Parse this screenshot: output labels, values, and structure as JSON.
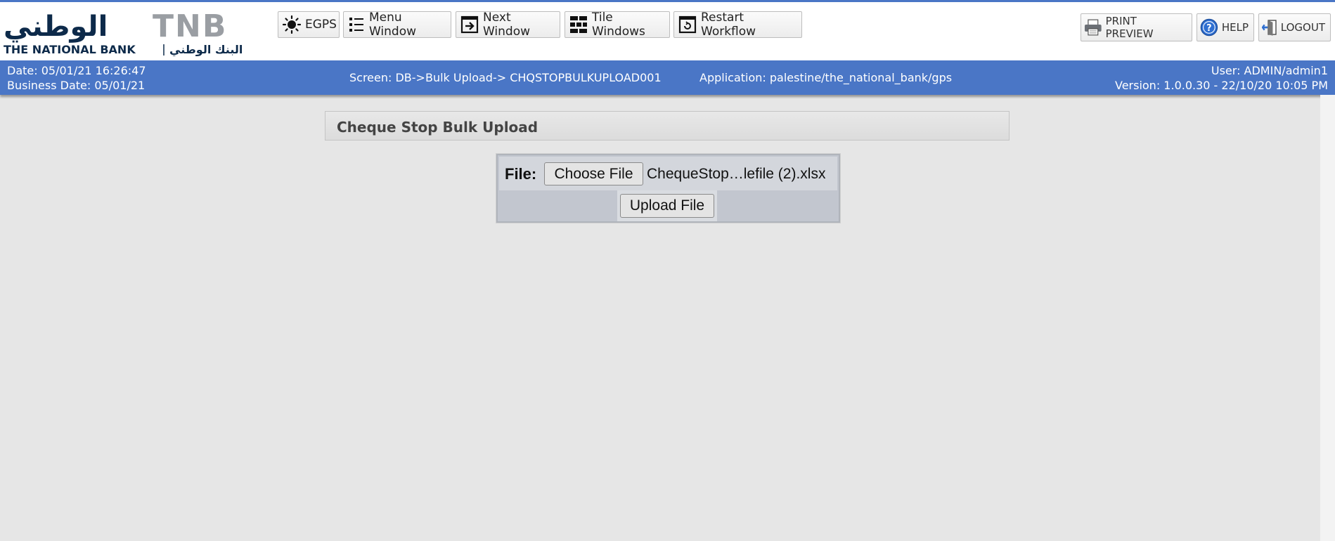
{
  "logo": {
    "arabic_name": "الوطني",
    "tnb": "TNB",
    "english_name": "THE NATIONAL BANK",
    "arabic_tagline": "البنك الوطني"
  },
  "toolbar": {
    "egps": "EGPS",
    "menu_window": "Menu Window",
    "next_window": "Next Window",
    "tile_windows": "Tile Windows",
    "restart_workflow": "Restart Workflow"
  },
  "right_toolbar": {
    "print_preview": "PRINT PREVIEW",
    "help": "HELP",
    "logout": "LOGOUT"
  },
  "info": {
    "date": "Date: 05/01/21 16:26:47",
    "business_date": "Business Date: 05/01/21",
    "screen": "Screen: DB->Bulk Upload-> CHQSTOPBULKUPLOAD001",
    "application": "Application: palestine/the_national_bank/gps",
    "user": "User: ADMIN/admin1",
    "version": "Version: 1.0.0.30 - 22/10/20 10:05 PM"
  },
  "panel": {
    "title": "Cheque Stop Bulk Upload"
  },
  "upload": {
    "file_label": "File:",
    "choose_label": "Choose File",
    "file_name": "ChequeStop…lefile (2).xlsx",
    "upload_label": "Upload File"
  },
  "icons": [
    "sun-icon",
    "list-icon",
    "next-window-icon",
    "tile-grid-icon",
    "restart-icon",
    "printer-icon",
    "help-icon",
    "logout-icon"
  ],
  "colors": {
    "infobar": "#4a76c6",
    "background": "#e6e6e6",
    "logo_dark": "#0d2a4a",
    "logo_gray": "#9a9ea3"
  }
}
